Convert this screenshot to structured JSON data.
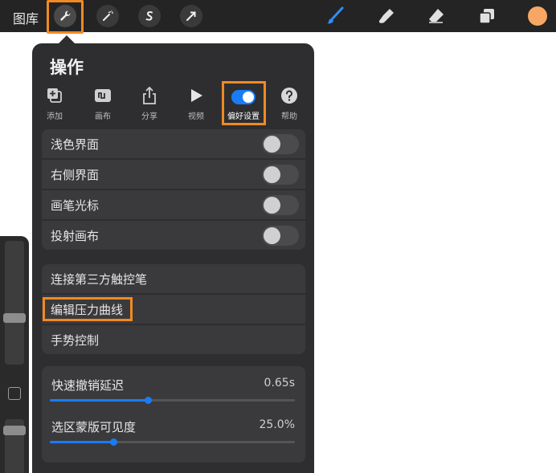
{
  "topbar": {
    "gallery_label": "图库",
    "tools": [
      "wrench-icon",
      "magic-wand-icon",
      "selection-s-icon",
      "arrow-icon"
    ],
    "right_tools": [
      "brush-icon",
      "smudge-icon",
      "eraser-icon",
      "layers-icon"
    ],
    "current_color": "#f7a763"
  },
  "popover": {
    "title": "操作",
    "tabs": [
      {
        "label": "添加",
        "icon": "add-icon"
      },
      {
        "label": "画布",
        "icon": "canvas-icon"
      },
      {
        "label": "分享",
        "icon": "share-icon"
      },
      {
        "label": "视频",
        "icon": "video-icon"
      },
      {
        "label": "偏好设置",
        "icon": "toggle-icon",
        "active": true
      },
      {
        "label": "帮助",
        "icon": "help-icon"
      }
    ],
    "toggles": [
      {
        "label": "浅色界面",
        "on": false
      },
      {
        "label": "右侧界面",
        "on": false
      },
      {
        "label": "画笔光标",
        "on": false
      },
      {
        "label": "投射画布",
        "on": false
      }
    ],
    "links": [
      {
        "label": "连接第三方触控笔"
      },
      {
        "label": "编辑压力曲线"
      },
      {
        "label": "手势控制"
      }
    ],
    "sliders": [
      {
        "label": "快速撤销延迟",
        "value": "0.65s",
        "fraction": 0.4
      },
      {
        "label": "选区蒙版可见度",
        "value": "25.0%",
        "fraction": 0.26
      }
    ]
  },
  "accent_color": "#1a7cf5",
  "highlight_color": "#f08a24"
}
